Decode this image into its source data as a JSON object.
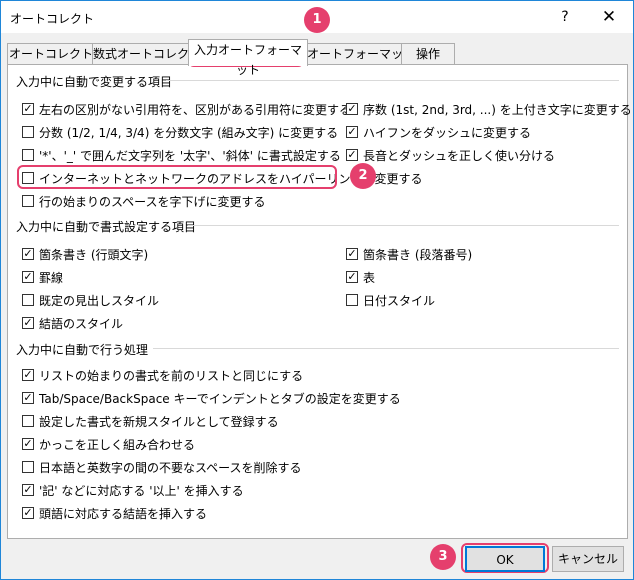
{
  "window": {
    "title": "オートコレクト",
    "help_icon": "question-icon",
    "close_icon": "close-icon"
  },
  "tabs": [
    {
      "label": "オートコレクト"
    },
    {
      "label": "数式オートコレクト"
    },
    {
      "label": "入力オートフォーマット",
      "active": true
    },
    {
      "label": "オートフォーマット"
    },
    {
      "label": "操作"
    }
  ],
  "sections": [
    {
      "title": "入力中に自動で変更する項目"
    },
    {
      "title": "入力中に自動で書式設定する項目"
    },
    {
      "title": "入力中に自動で行う処理"
    }
  ],
  "options": [
    {
      "label": "左右の区別がない引用符を、区別がある引用符に変更する",
      "checked": true
    },
    {
      "label": "分数 (1/2, 1/4, 3/4) を分数文字 (組み文字) に変更する",
      "checked": false
    },
    {
      "label": "'*'、'_' で囲んだ文字列を '太字'、'斜体' に書式設定する",
      "checked": false
    },
    {
      "label": "インターネットとネットワークのアドレスをハイパーリンクに変更する",
      "checked": false
    },
    {
      "label": "行の始まりのスペースを字下げに変更する",
      "checked": false
    },
    {
      "label": "序数 (1st, 2nd, 3rd, ...) を上付き文字に変更する",
      "checked": true
    },
    {
      "label": "ハイフンをダッシュに変更する",
      "checked": true
    },
    {
      "label": "長音とダッシュを正しく使い分ける",
      "checked": true
    },
    {
      "label": "箇条書き (行頭文字)",
      "checked": true
    },
    {
      "label": "罫線",
      "checked": true
    },
    {
      "label": "既定の見出しスタイル",
      "checked": false
    },
    {
      "label": "結語のスタイル",
      "checked": true
    },
    {
      "label": "箇条書き (段落番号)",
      "checked": true
    },
    {
      "label": "表",
      "checked": true
    },
    {
      "label": "日付スタイル",
      "checked": false
    },
    {
      "label": "リストの始まりの書式を前のリストと同じにする",
      "checked": true
    },
    {
      "label": "Tab/Space/BackSpace キーでインデントとタブの設定を変更する",
      "checked": true
    },
    {
      "label": "設定した書式を新規スタイルとして登録する",
      "checked": false
    },
    {
      "label": "かっこを正しく組み合わせる",
      "checked": true
    },
    {
      "label": "日本語と英数字の間の不要なスペースを削除する",
      "checked": false
    },
    {
      "label": "'記' などに対応する '以上' を挿入する",
      "checked": true
    },
    {
      "label": "頭語に対応する結語を挿入する",
      "checked": true
    }
  ],
  "badges": [
    "1",
    "2",
    "3"
  ],
  "buttons": {
    "ok": "OK",
    "cancel": "キャンセル"
  },
  "colors": {
    "accent": "#e53f6d",
    "focus": "#0078d7"
  }
}
